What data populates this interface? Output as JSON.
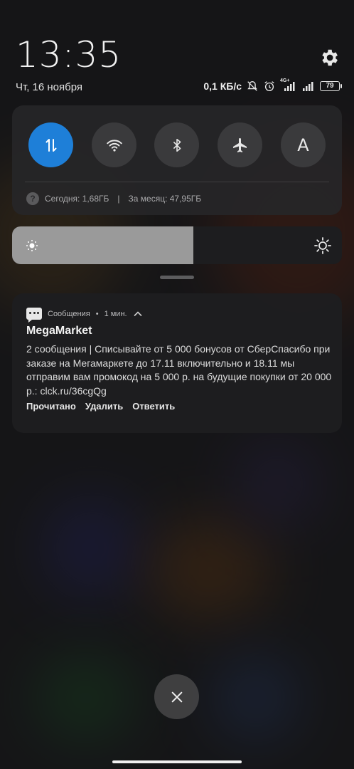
{
  "header": {
    "time": "13:35",
    "date": "Чт, 16 ноября"
  },
  "status_bar": {
    "net_speed": "0,1 КБ/с",
    "network_badge": "4G+",
    "battery": "79",
    "icons": [
      "bell-off-icon",
      "alarm-icon",
      "signal-icon",
      "signal-icon",
      "battery-icon"
    ]
  },
  "quick_settings": {
    "toggles": [
      {
        "name": "mobile-data",
        "icon": "data-arrows-icon",
        "active": true
      },
      {
        "name": "wifi",
        "icon": "wifi-icon",
        "active": false
      },
      {
        "name": "bluetooth",
        "icon": "bluetooth-icon",
        "active": false
      },
      {
        "name": "airplane",
        "icon": "airplane-icon",
        "active": false
      },
      {
        "name": "auto-brightness",
        "icon": "letter-a-icon",
        "label": "A",
        "active": false
      }
    ],
    "usage_today": "Сегодня: 1,68ГБ",
    "separator": "|",
    "usage_month": "За месяц: 47,95ГБ",
    "help_icon": "?"
  },
  "brightness": {
    "level": 0.55
  },
  "notification": {
    "app": "Сообщения",
    "dot": "•",
    "time": "1 мин.",
    "title": "MegaMarket",
    "body": "2 сообщения | Списывайте от 5 000 бонусов от СберСпасибо при заказе на Мегамаркете до 17.11 включительно и 18.11 мы отправим вам промокод на 5 000 р. на будущие покупки от 20 000 р.: clck.ru/36cgQg",
    "actions": {
      "read": "Прочитано",
      "delete": "Удалить",
      "reply": "Ответить"
    }
  },
  "colors": {
    "accent": "#1e7fd8",
    "card": "#262628",
    "text": "#e8e8e8"
  }
}
